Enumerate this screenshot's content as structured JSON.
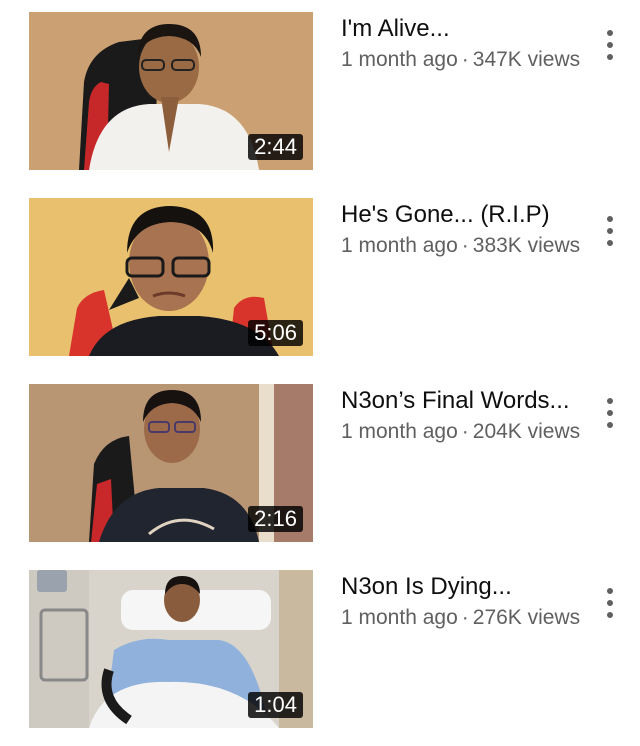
{
  "videos": [
    {
      "title": "I'm Alive...",
      "age": "1 month ago",
      "views": "347K views",
      "duration": "2:44",
      "separator": "·"
    },
    {
      "title": "He's Gone... (R.I.P)",
      "age": "1 month ago",
      "views": "383K views",
      "duration": "5:06",
      "separator": "·"
    },
    {
      "title": "N3on’s Final Words...",
      "age": "1 month ago",
      "views": "204K views",
      "duration": "2:16",
      "separator": "·"
    },
    {
      "title": "N3on Is Dying...",
      "age": "1 month ago",
      "views": "276K views",
      "duration": "1:04",
      "separator": "·"
    }
  ],
  "icons": {
    "more": "more-vert-icon"
  },
  "colors": {
    "title": "#0f0f0f",
    "meta": "#606060",
    "duration_bg": "#000000"
  }
}
